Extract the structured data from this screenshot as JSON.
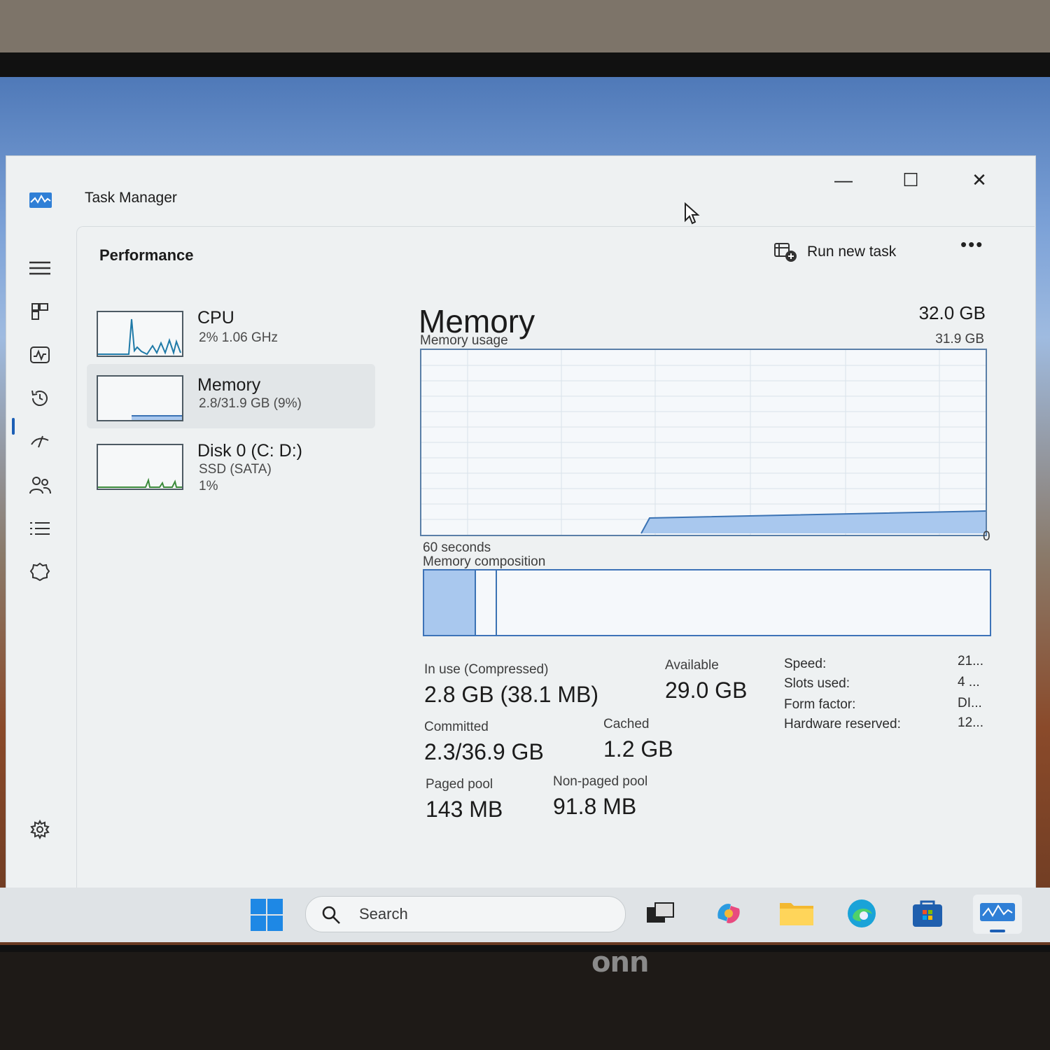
{
  "window": {
    "title": "Task Manager"
  },
  "toolbar": {
    "page_title": "Performance",
    "run_new_task": "Run new task",
    "more": "•••"
  },
  "resources": [
    {
      "name": "CPU",
      "sub1": "2%  1.06 GHz",
      "sub2": ""
    },
    {
      "name": "Memory",
      "sub1": "2.8/31.9 GB (9%)",
      "sub2": ""
    },
    {
      "name": "Disk 0 (C: D:)",
      "sub1": "SSD (SATA)",
      "sub2": "1%"
    }
  ],
  "memory": {
    "title": "Memory",
    "total": "32.0 GB",
    "usage_label": "Memory usage",
    "usage_max": "31.9 GB",
    "time_label": "60 seconds",
    "zero": "0",
    "composition_label": "Memory composition",
    "in_use_label": "In use (Compressed)",
    "in_use_value": "2.8 GB (38.1 MB)",
    "available_label": "Available",
    "available_value": "29.0 GB",
    "committed_label": "Committed",
    "committed_value": "2.3/36.9 GB",
    "cached_label": "Cached",
    "cached_value": "1.2 GB",
    "paged_label": "Paged pool",
    "paged_value": "143 MB",
    "nonpaged_label": "Non-paged pool",
    "nonpaged_value": "91.8 MB",
    "specs": [
      {
        "label": "Speed:",
        "value": "21..."
      },
      {
        "label": "Slots used:",
        "value": "4 ..."
      },
      {
        "label": "Form factor:",
        "value": "DI..."
      },
      {
        "label": "Hardware reserved:",
        "value": "12..."
      }
    ]
  },
  "taskbar": {
    "search_placeholder": "Search"
  },
  "monitor": {
    "brand": "onn"
  },
  "colors": {
    "accent": "#1c5fb5",
    "graph_fill": "#a9c8ee",
    "graph_line": "#5a7fa8"
  }
}
